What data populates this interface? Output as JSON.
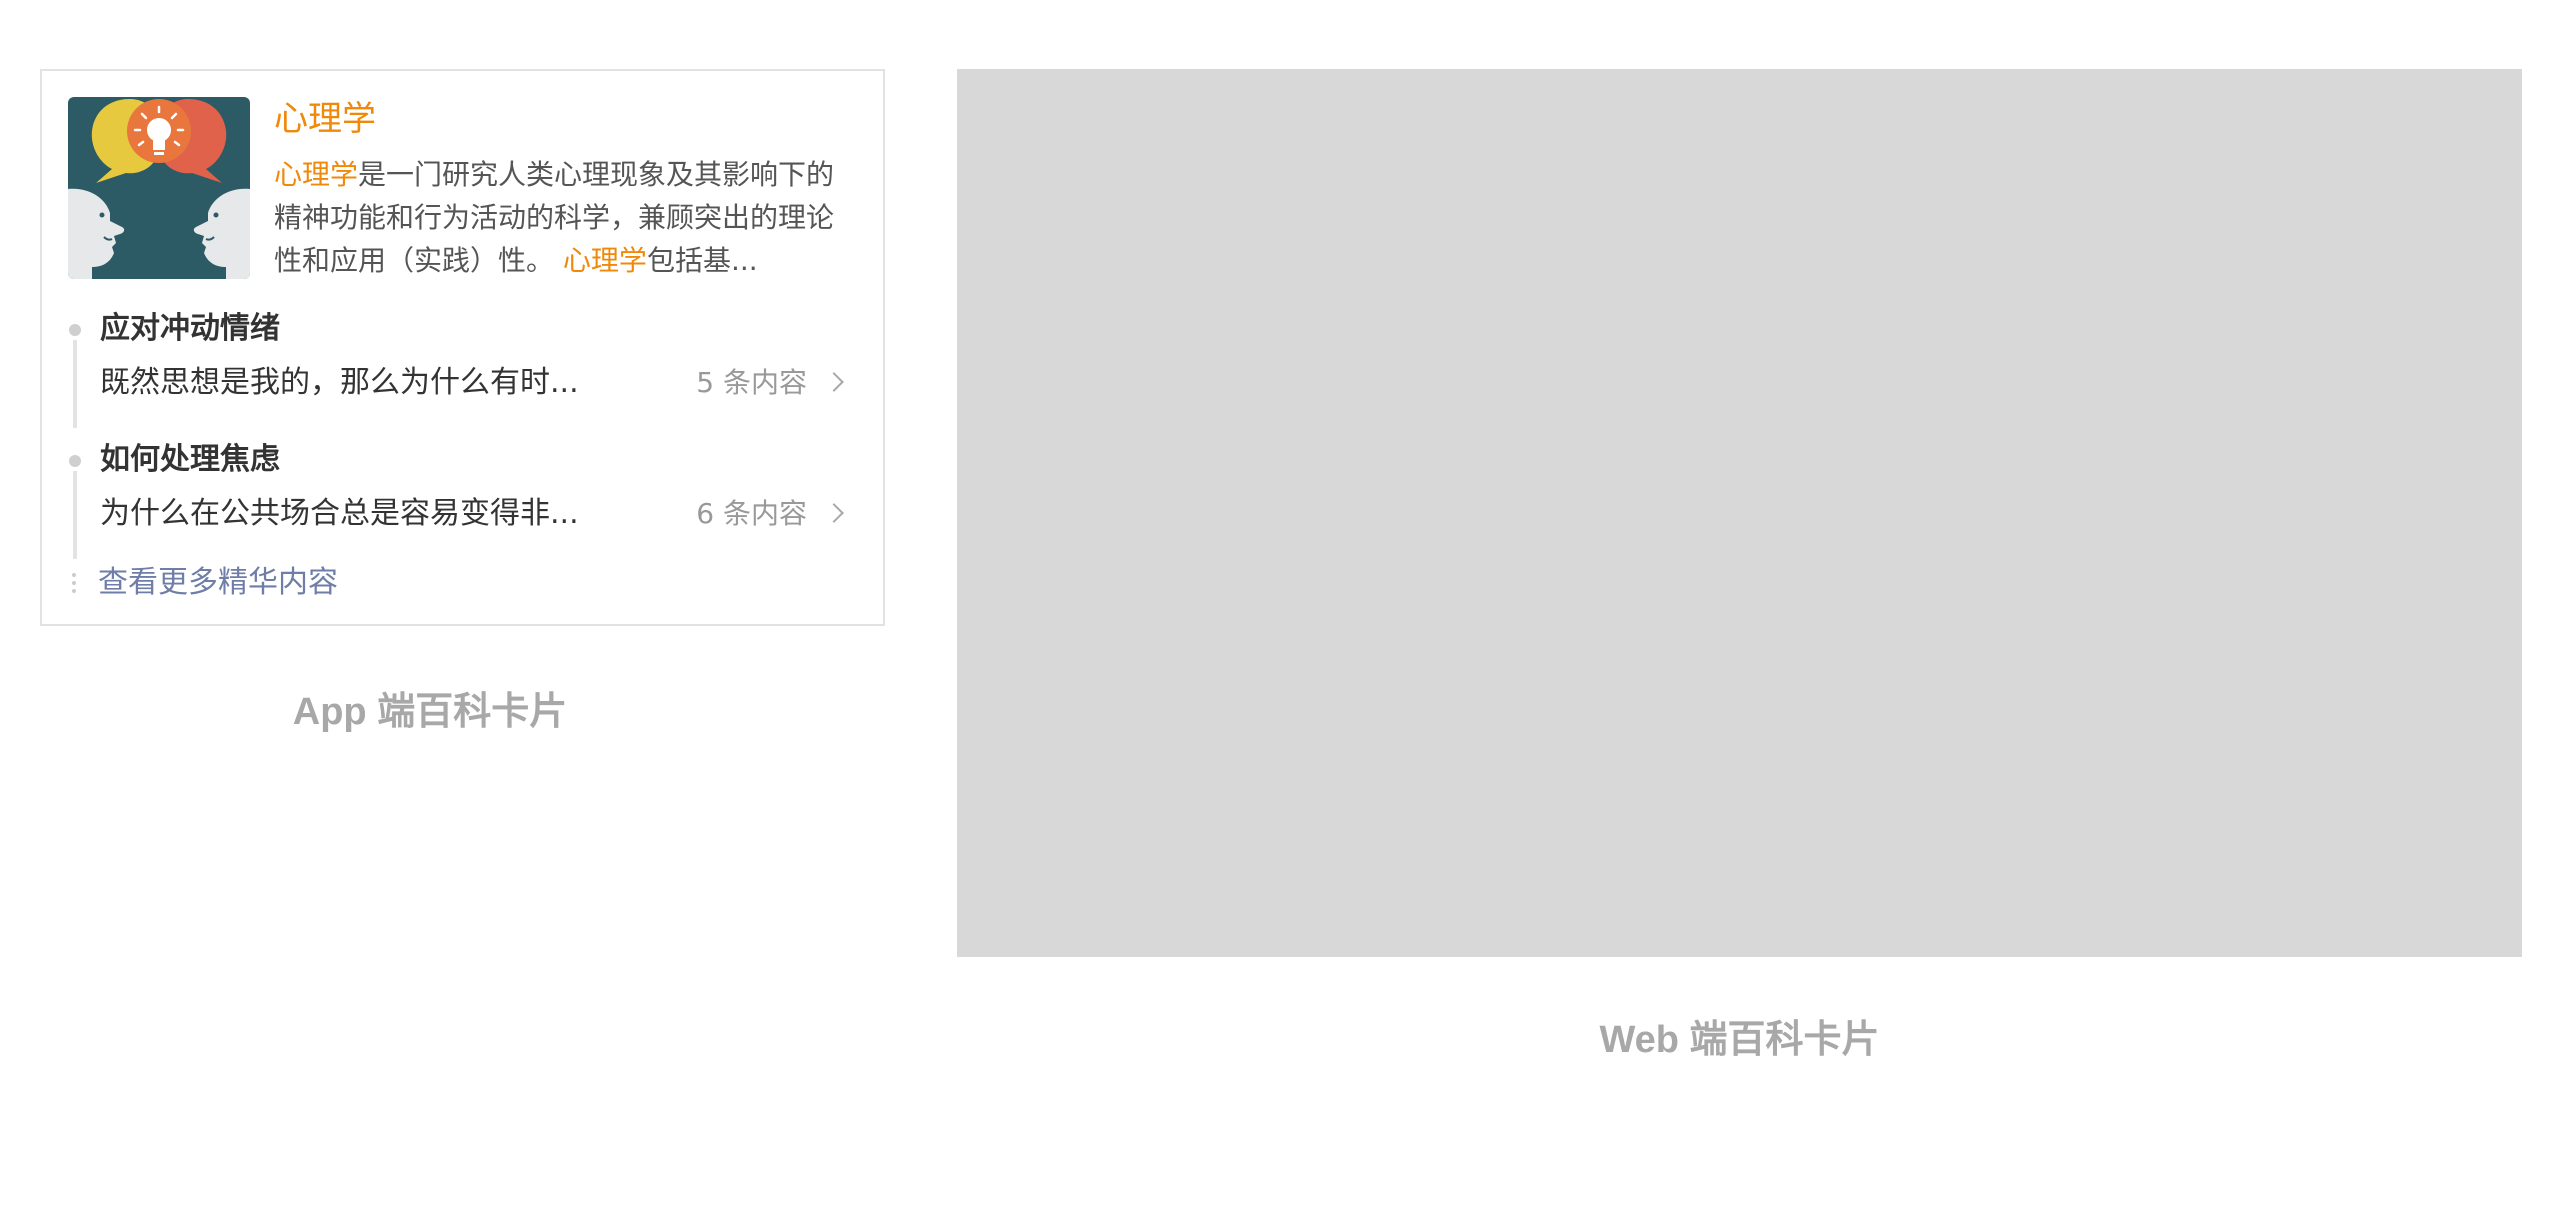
{
  "app_card": {
    "entry": {
      "title": "心理学",
      "image_icon": "psychology-faces-lightbulb",
      "description": {
        "term_1": "心理学",
        "text_1": "是一门研究人类心理现象及其影响下的精神功能和行为活动的科学，兼顾突出的理论性和应用（实践）性。",
        "term_2": "心理学",
        "text_2": "包括基..."
      }
    },
    "topics": [
      {
        "title": "应对冲动情绪",
        "summary": "既然思想是我的，那么为什么有时...",
        "count": "5 条内容"
      },
      {
        "title": "如何处理焦虑",
        "summary": "为什么在公共场合总是容易变得非...",
        "count": "6 条内容"
      }
    ],
    "more_link": "查看更多精华内容",
    "caption": "App 端百科卡片"
  },
  "web_card": {
    "caption": "Web 端百科卡片"
  },
  "colors": {
    "accent": "#f0890a",
    "link": "#6f7ea8",
    "placeholder": "#d8d8d8",
    "image_bg": "#2c5b66",
    "bubble_yellow": "#e6c93e",
    "bubble_red": "#e0624a",
    "bubble_orange": "#ee8a3a"
  }
}
